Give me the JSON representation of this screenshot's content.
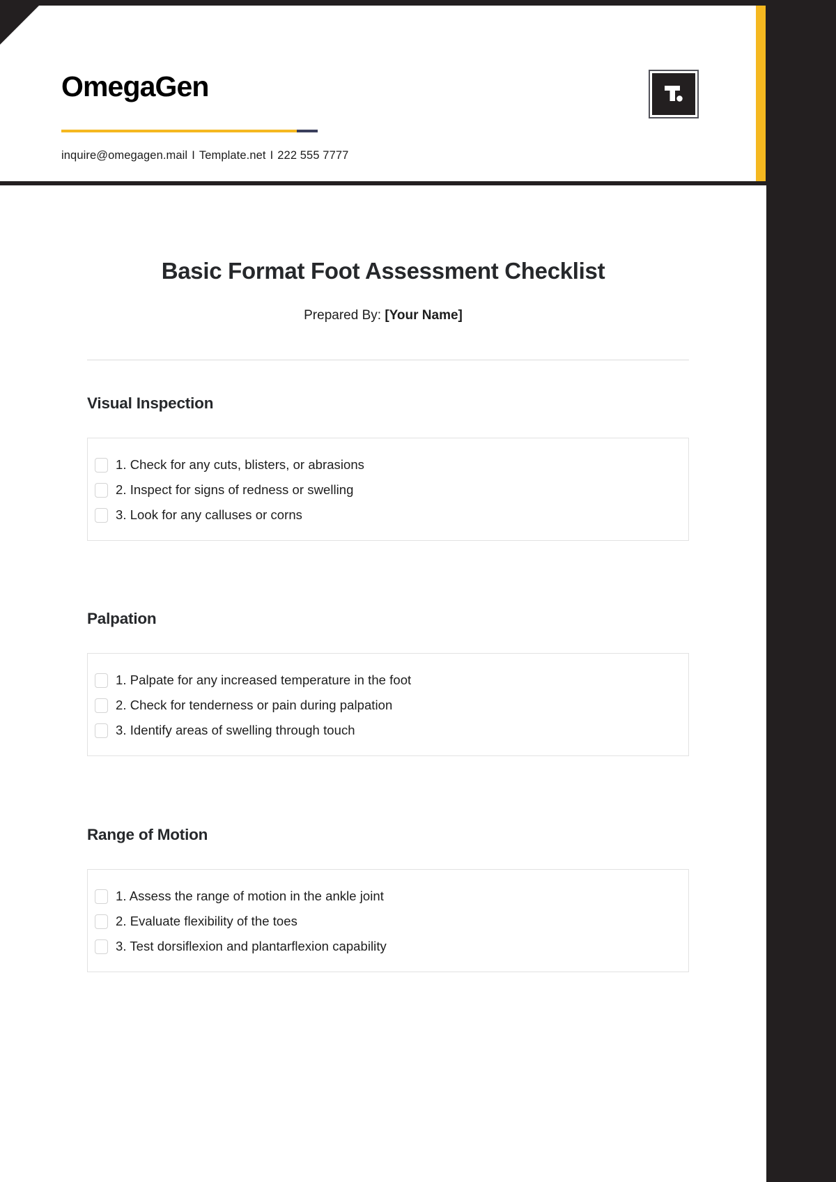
{
  "header": {
    "brand_name": "OmegaGen",
    "contact": {
      "email": "inquire@omegagen.mail",
      "website": "Template.net",
      "phone": "222 555 7777",
      "separator": "I"
    },
    "badge_text": "T.",
    "accent_color": "#f5b820",
    "navy_color": "#3a3f5c"
  },
  "document": {
    "title": "Basic Format Foot Assessment Checklist",
    "prepared_by_label": "Prepared By:",
    "prepared_by_value": "[Your Name]"
  },
  "sections": [
    {
      "heading": "Visual Inspection",
      "items": [
        "1. Check for any cuts, blisters, or abrasions",
        "2. Inspect for signs of redness or swelling",
        "3. Look for any calluses or corns"
      ]
    },
    {
      "heading": "Palpation",
      "items": [
        "1. Palpate for any increased temperature in the foot",
        "2. Check for tenderness or pain during palpation",
        "3. Identify areas of swelling through touch"
      ]
    },
    {
      "heading": "Range of Motion",
      "items": [
        "1. Assess the range of motion in the ankle joint",
        "2. Evaluate flexibility of the toes",
        "3. Test dorsiflexion and plantarflexion capability"
      ]
    }
  ]
}
